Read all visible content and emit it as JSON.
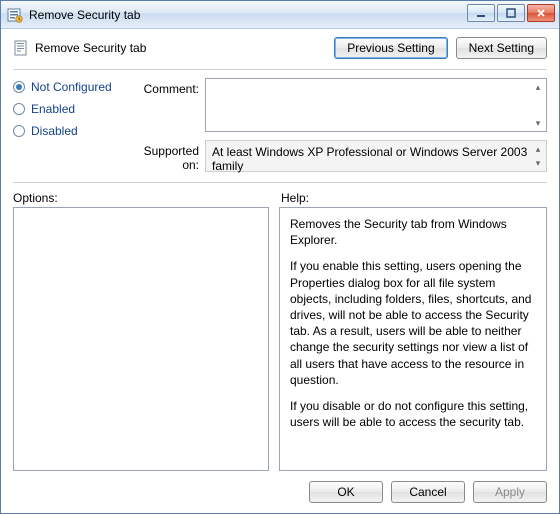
{
  "window": {
    "title": "Remove Security tab"
  },
  "header": {
    "title": "Remove Security tab",
    "prev_label": "Previous Setting",
    "next_label": "Next Setting"
  },
  "settings": {
    "radios": {
      "not_configured": "Not Configured",
      "enabled": "Enabled",
      "disabled": "Disabled",
      "selected": "not_configured"
    },
    "comment_label": "Comment:",
    "comment_value": "",
    "supported_label": "Supported on:",
    "supported_value": "At least Windows XP Professional or Windows Server 2003 family"
  },
  "labels": {
    "options": "Options:",
    "help": "Help:"
  },
  "help": {
    "p1": "Removes the Security tab from Windows Explorer.",
    "p2": "If you enable this setting, users opening the Properties dialog box for all file system objects, including folders, files, shortcuts, and drives, will not be able to access the Security tab. As a result, users will be able to neither change the security settings nor view a list of all users that have access to the resource in question.",
    "p3": "If you disable or do not configure this setting, users will be able to access the security tab."
  },
  "footer": {
    "ok": "OK",
    "cancel": "Cancel",
    "apply": "Apply"
  }
}
